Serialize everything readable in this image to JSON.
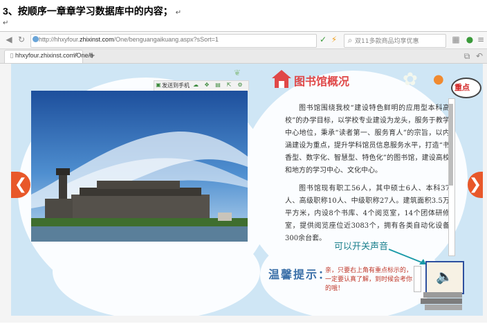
{
  "doc": {
    "heading_number": "3、",
    "heading_text": "按顺序一章章学习数据库中的内容；",
    "para_mark": "↵"
  },
  "browser": {
    "url_prefix": "http://hhxyfour.",
    "url_domain": "zhixinst.com",
    "url_path": "/One/benguangaikuang.aspx?sSort=1",
    "search_placeholder": "双11多款商品均享优惠",
    "tab_title": "hhxyfour.zhixinst.com/One/b",
    "tab_close": "×",
    "new_tab": "+"
  },
  "photo_toolbar": {
    "send_to_phone": "发送到手机"
  },
  "page": {
    "heading": "图书馆概况",
    "paragraphs": [
      "图书馆围绕我校“建设特色鲜明的应用型本科高校”的办学目标，以学校专业建设为龙头，服务于教学中心地位，秉承“读者第一、服务育人”的宗旨，以内涵建设为重点，提升学科馆员信息服务水平，打造“书香型、数字化、智慧型、特色化”的图书馆，建设高校和地方的学习中心、文化中心。",
      "图书馆现有职工56人，其中硕士6人、本科37人、高级职称10人、中级职称27人。建筑面积3.5万平方米，内设8个书库、4个阅览室，14个团体研修室，提供阅览座位近3083个，拥有各类自动化设备300余台套。"
    ],
    "key_point": "重点",
    "annotation": "可以开关声音",
    "tip_title": "温馨提示：",
    "tip_text": "亲，只要右上角有重点标示的，一定要认真了解，到时候会考你的哦！",
    "prev_arrow": "❮",
    "next_arrow": "❯"
  },
  "colors": {
    "accent_red": "#e04848",
    "sky_blue": "#cfe6f5",
    "arrow_orange": "#e8582a",
    "annotation_teal": "#1a7f8c"
  }
}
